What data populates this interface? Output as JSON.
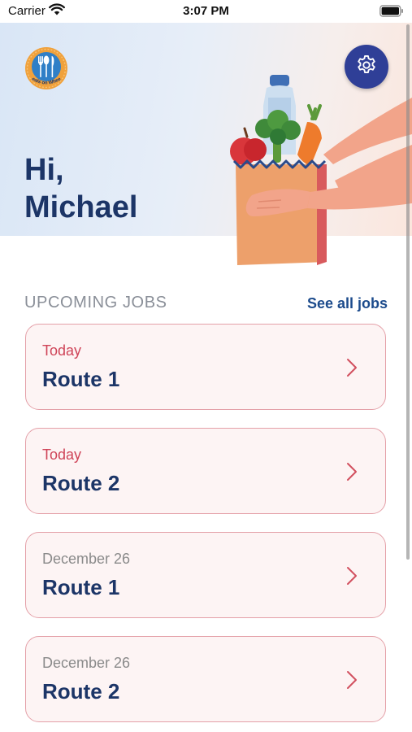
{
  "status_bar": {
    "carrier": "Carrier",
    "time": "3:07 PM"
  },
  "header": {
    "greeting_line1": "Hi,",
    "greeting_line2": "Michael",
    "logo_text": "Meals on Wheels"
  },
  "upcoming": {
    "title": "UPCOMING JOBS",
    "see_all_label": "See all jobs",
    "jobs": [
      {
        "date": "Today",
        "route": "Route 1"
      },
      {
        "date": "Today",
        "route": "Route 2"
      },
      {
        "date": "December 26",
        "route": "Route 1"
      },
      {
        "date": "December 26",
        "route": "Route 2"
      }
    ]
  },
  "icons": {
    "settings": "gear-icon",
    "chevron": "chevron-right-icon",
    "wifi": "wifi-icon",
    "battery": "battery-icon"
  },
  "colors": {
    "brand_navy": "#1c3567",
    "settings_button": "#2f3f97",
    "today_red": "#cf4458",
    "card_border": "#e4a0a8",
    "card_bg": "#fdf4f4",
    "muted_gray": "#8a8f98"
  }
}
